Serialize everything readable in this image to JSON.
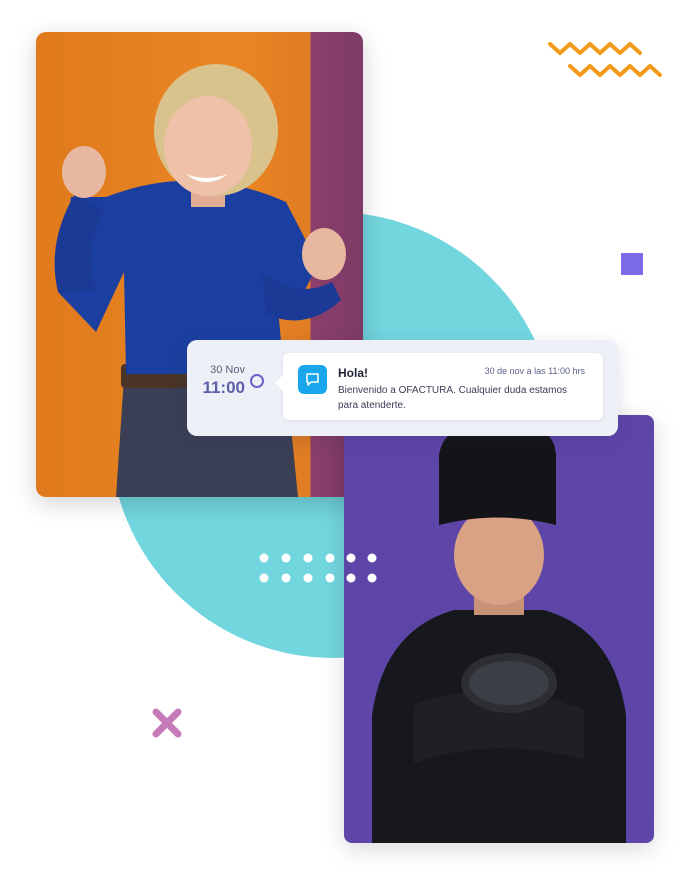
{
  "notification": {
    "date": "30 Nov",
    "time": "11:00",
    "title": "Hola!",
    "timestamp": "30 de nov a las 11:00 hrs",
    "message": "Bienvenido a OFACTURA. Cualquier duda estamos para atenderte.",
    "icon": "chat-bubble-icon"
  },
  "colors": {
    "circle": "#72d6df",
    "accent_purple": "#7b6be6",
    "zigzag_orange": "#f39a1a",
    "cross_pink": "#c67bb8",
    "chat_icon_blue": "#1aa6ec",
    "card1_orange": "#e98624",
    "card2_purple": "#5e45a8"
  },
  "images": {
    "card1": "photo of a smiling woman with raised fists, blue shirt, orange background",
    "card2": "photo of a chef in black uniform holding a pan, purple background"
  }
}
